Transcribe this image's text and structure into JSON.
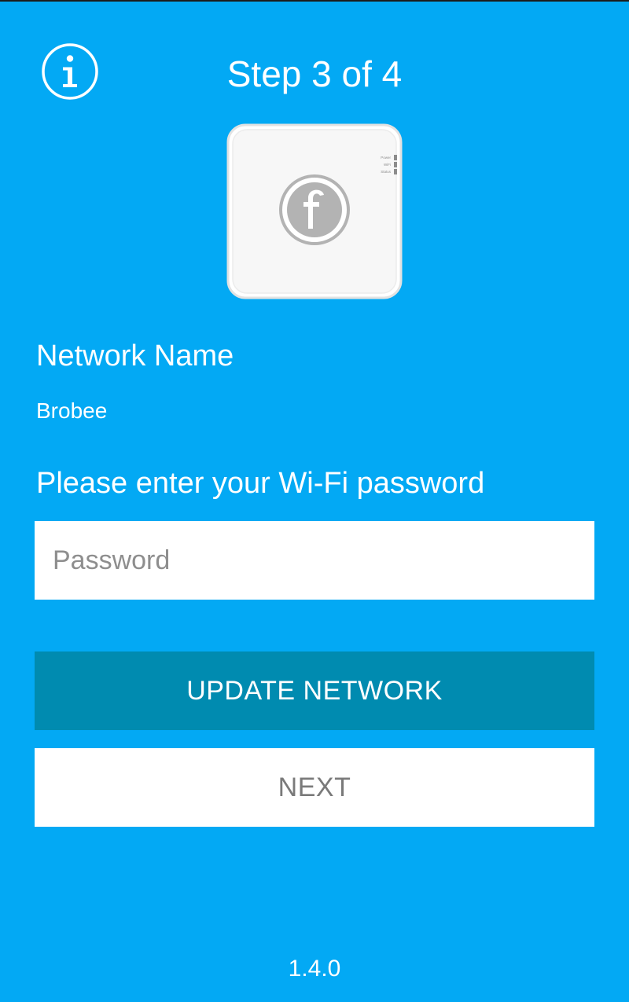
{
  "header": {
    "step_title": "Step 3 of 4",
    "info_icon": "info-circle-icon"
  },
  "device": {
    "image": "hub-device-image",
    "led_labels": [
      "Power",
      "WiFi",
      "Status"
    ]
  },
  "network": {
    "label": "Network Name",
    "value": "Brobee"
  },
  "password": {
    "prompt": "Please enter your Wi-Fi password",
    "placeholder": "Password",
    "value": ""
  },
  "buttons": {
    "update_label": "UPDATE NETWORK",
    "next_label": "NEXT"
  },
  "footer": {
    "version": "1.4.0"
  },
  "colors": {
    "background": "#03a9f4",
    "primary_button": "#008bb0",
    "secondary_button": "#ffffff",
    "text": "#ffffff"
  }
}
